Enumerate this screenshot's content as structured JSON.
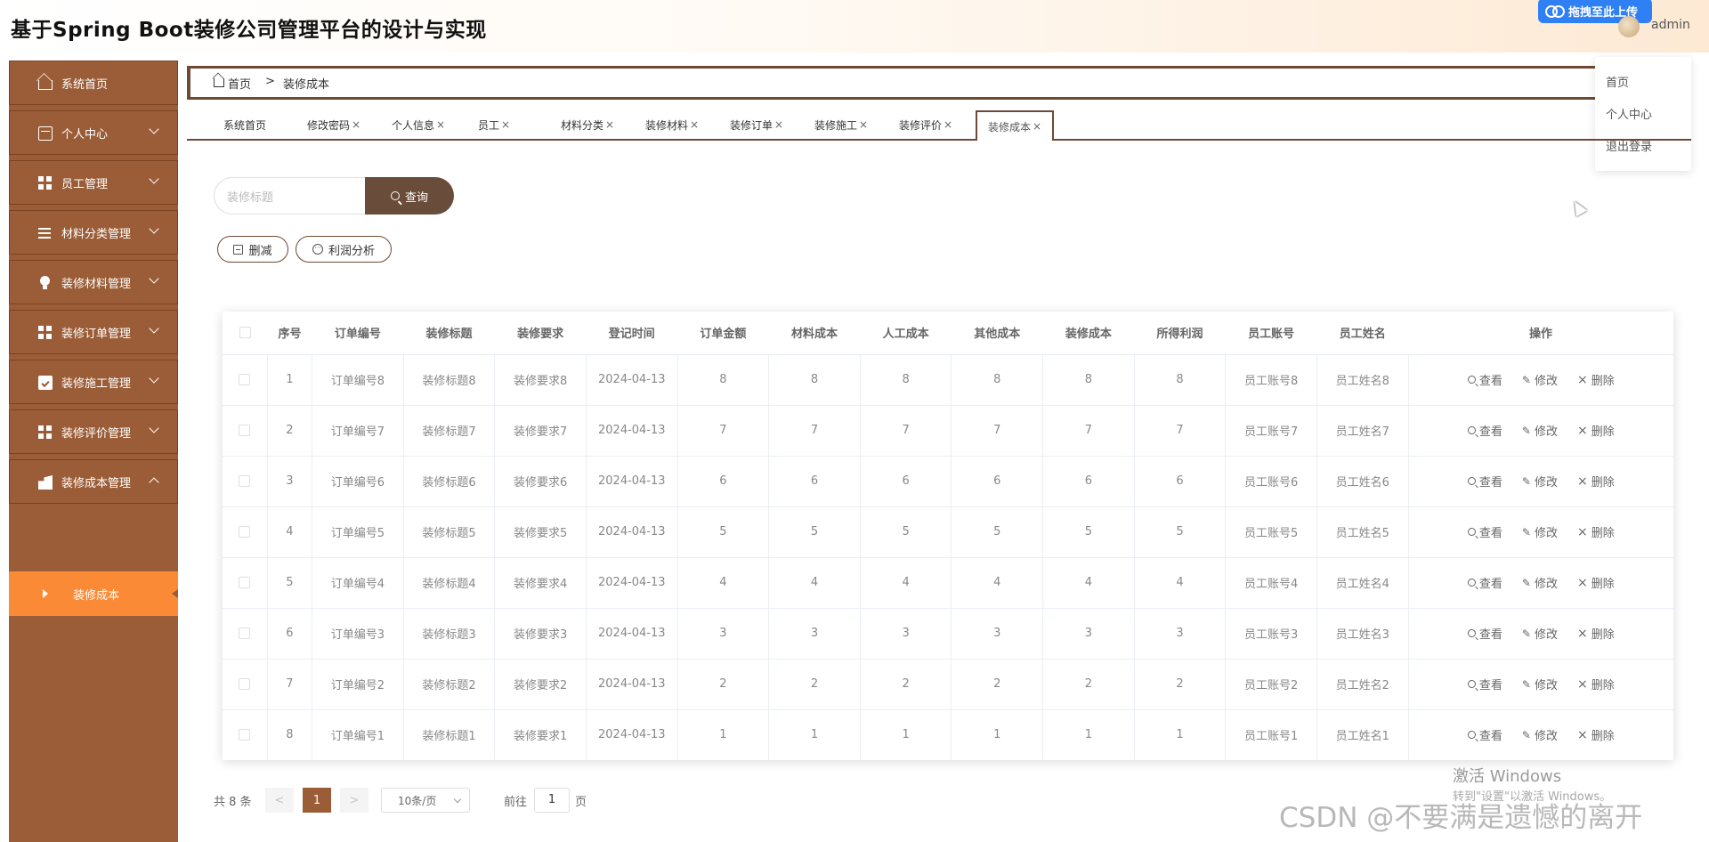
{
  "header": {
    "title": "基于Spring Boot装修公司管理平台的设计与实现",
    "upload_label": "拖拽至此上传",
    "username": "admin"
  },
  "sidebar": {
    "items": [
      {
        "label": "系统首页",
        "icon": "home-icon",
        "has_arrow": false
      },
      {
        "label": "个人中心",
        "icon": "card-icon",
        "has_arrow": true
      },
      {
        "label": "员工管理",
        "icon": "grid-icon",
        "has_arrow": true
      },
      {
        "label": "材料分类管理",
        "icon": "list-icon",
        "has_arrow": true
      },
      {
        "label": "装修材料管理",
        "icon": "bulb-icon",
        "has_arrow": true
      },
      {
        "label": "装修订单管理",
        "icon": "grid-icon",
        "has_arrow": true
      },
      {
        "label": "装修施工管理",
        "icon": "clipboard-icon",
        "has_arrow": true
      },
      {
        "label": "装修评价管理",
        "icon": "grid-icon",
        "has_arrow": true
      },
      {
        "label": "装修成本管理",
        "icon": "cost-icon",
        "has_arrow": true
      }
    ],
    "active_sub": "装修成本"
  },
  "breadcrumb": {
    "home": "首页",
    "separator": ">",
    "current": "装修成本"
  },
  "dropdown": {
    "items": [
      "首页",
      "个人中心",
      "退出登录"
    ]
  },
  "tabs": [
    {
      "label": "系统首页",
      "closable": false
    },
    {
      "label": "修改密码",
      "closable": true
    },
    {
      "label": "个人信息",
      "closable": true
    },
    {
      "label": "员工",
      "closable": true
    },
    {
      "label": "材料分类",
      "closable": true
    },
    {
      "label": "装修材料",
      "closable": true
    },
    {
      "label": "装修订单",
      "closable": true
    },
    {
      "label": "装修施工",
      "closable": true
    },
    {
      "label": "装修评价",
      "closable": true
    },
    {
      "label": "装修成本",
      "closable": true
    }
  ],
  "search": {
    "placeholder": "装修标题",
    "button_label": "查询"
  },
  "actions": {
    "delete_label": "删减",
    "analysis_label": "利润分析"
  },
  "table": {
    "headers": [
      "序号",
      "订单编号",
      "装修标题",
      "装修要求",
      "登记时间",
      "订单金额",
      "材料成本",
      "人工成本",
      "其他成本",
      "装修成本",
      "所得利润",
      "员工账号",
      "员工姓名",
      "操作"
    ],
    "rows": [
      [
        "1",
        "订单编号8",
        "装修标题8",
        "装修要求8",
        "2024-04-13",
        "8",
        "8",
        "8",
        "8",
        "8",
        "8",
        "员工账号8",
        "员工姓名8"
      ],
      [
        "2",
        "订单编号7",
        "装修标题7",
        "装修要求7",
        "2024-04-13",
        "7",
        "7",
        "7",
        "7",
        "7",
        "7",
        "员工账号7",
        "员工姓名7"
      ],
      [
        "3",
        "订单编号6",
        "装修标题6",
        "装修要求6",
        "2024-04-13",
        "6",
        "6",
        "6",
        "6",
        "6",
        "6",
        "员工账号6",
        "员工姓名6"
      ],
      [
        "4",
        "订单编号5",
        "装修标题5",
        "装修要求5",
        "2024-04-13",
        "5",
        "5",
        "5",
        "5",
        "5",
        "5",
        "员工账号5",
        "员工姓名5"
      ],
      [
        "5",
        "订单编号4",
        "装修标题4",
        "装修要求4",
        "2024-04-13",
        "4",
        "4",
        "4",
        "4",
        "4",
        "4",
        "员工账号4",
        "员工姓名4"
      ],
      [
        "6",
        "订单编号3",
        "装修标题3",
        "装修要求3",
        "2024-04-13",
        "3",
        "3",
        "3",
        "3",
        "3",
        "3",
        "员工账号3",
        "员工姓名3"
      ],
      [
        "7",
        "订单编号2",
        "装修标题2",
        "装修要求2",
        "2024-04-13",
        "2",
        "2",
        "2",
        "2",
        "2",
        "2",
        "员工账号2",
        "员工姓名2"
      ],
      [
        "8",
        "订单编号1",
        "装修标题1",
        "装修要求1",
        "2024-04-13",
        "1",
        "1",
        "1",
        "1",
        "1",
        "1",
        "员工账号1",
        "员工姓名1"
      ]
    ],
    "ops": {
      "view": "查看",
      "edit": "修改",
      "delete": "删除"
    }
  },
  "pagination": {
    "total_text": "共 8 条",
    "prev": "<",
    "next": ">",
    "current_page": "1",
    "page_size": "10条/页",
    "goto_label": "前往",
    "goto_value": "1",
    "page_unit": "页"
  },
  "watermarks": {
    "windows_line1": "激活 Windows",
    "windows_line2": "转到\"设置\"以激活 Windows。",
    "csdn": "CSDN @不要满是遗憾的离开"
  },
  "colors": {
    "sidebar": "#9b5d37",
    "active_sub": "#fb8a36",
    "accent": "#6e4a33",
    "search_button": "#6a4c3a"
  }
}
